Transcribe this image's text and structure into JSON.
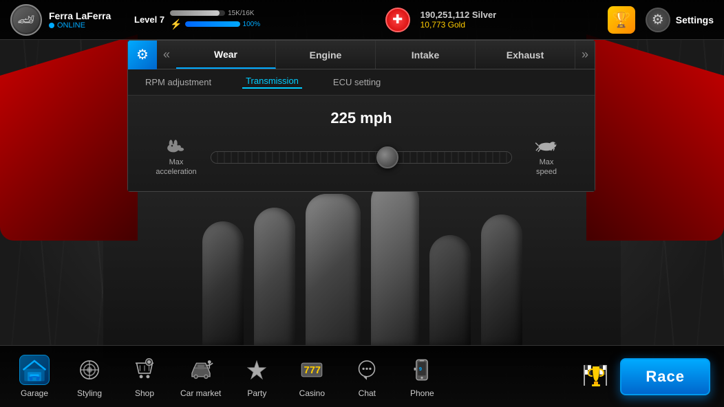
{
  "header": {
    "profile": {
      "name": "Ferra LaFerra",
      "status": "ONLINE"
    },
    "level": {
      "label": "Level 7",
      "xp_current": "15K",
      "xp_max": "16K",
      "lightning_pct": "100%"
    },
    "currency": {
      "silver": "190,251,112 Silver",
      "gold": "10,773 Gold"
    },
    "settings_label": "Settings"
  },
  "panel": {
    "tabs": [
      {
        "label": "Wear",
        "active": true
      },
      {
        "label": "Engine",
        "active": false
      },
      {
        "label": "Intake",
        "active": false
      },
      {
        "label": "Exhaust",
        "active": false
      }
    ],
    "sub_tabs": [
      {
        "label": "RPM adjustment",
        "active": false
      },
      {
        "label": "Transmission",
        "active": true
      },
      {
        "label": "ECU setting",
        "active": false
      }
    ],
    "speed": {
      "value": "225 mph"
    },
    "slider": {
      "left_label1": "Max",
      "left_label2": "acceleration",
      "right_label1": "Max",
      "right_label2": "speed"
    }
  },
  "bottom_nav": {
    "items": [
      {
        "label": "Garage",
        "icon": "garage"
      },
      {
        "label": "Styling",
        "icon": "styling"
      },
      {
        "label": "Shop",
        "icon": "shop"
      },
      {
        "label": "Car market",
        "icon": "car-market"
      },
      {
        "label": "Party",
        "icon": "party"
      },
      {
        "label": "Casino",
        "icon": "casino"
      },
      {
        "label": "Chat",
        "icon": "chat"
      },
      {
        "label": "Phone",
        "icon": "phone"
      }
    ],
    "race_button": "Race"
  }
}
